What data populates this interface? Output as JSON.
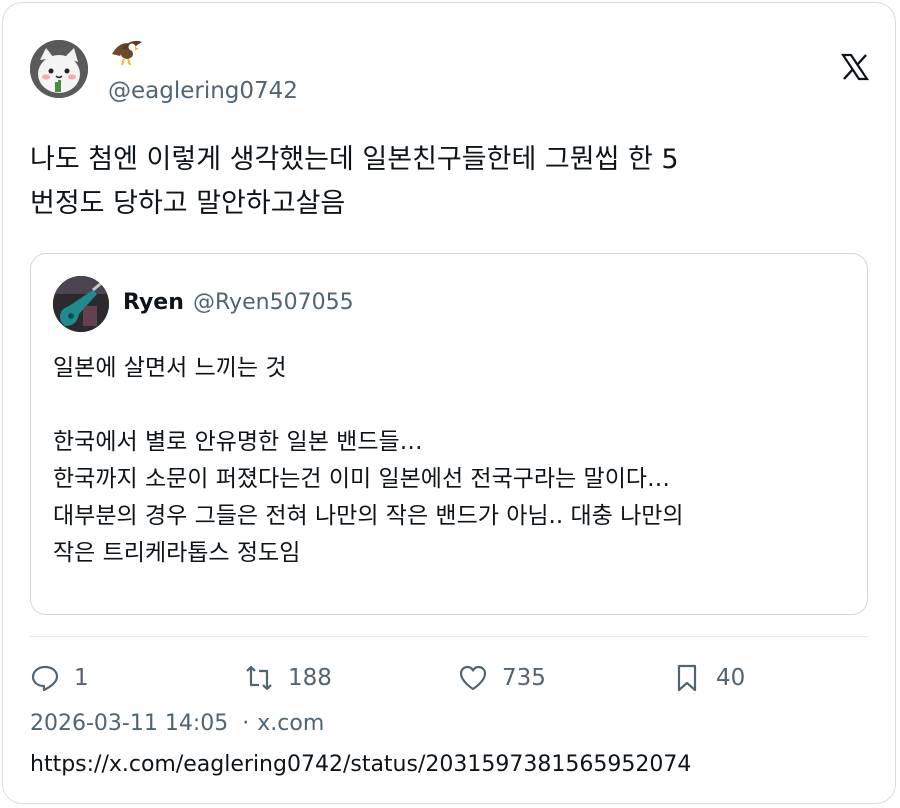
{
  "author": {
    "name_emoji": "eagle",
    "handle": "@eaglering0742"
  },
  "tweet": {
    "text": "나도 첨엔 이렇게 생각했는데 일본친구들한테 그뭔씹 한 5\n번정도 당하고 말안하고살음"
  },
  "quote": {
    "name": "Ryen",
    "handle": "@Ryen507055",
    "text": "일본에 살면서 느끼는 것\n\n한국에서 별로 안유명한 일본 밴드들…\n한국까지 소문이 퍼졌다는건 이미 일본에선 전국구라는 말이다…\n대부분의 경우 그들은 전혀 나만의 작은 밴드가 아님.. 대충 나만의\n작은 트리케라톱스 정도임"
  },
  "stats": {
    "replies": "1",
    "retweets": "188",
    "likes": "735",
    "bookmarks": "40"
  },
  "meta": {
    "timestamp": "2026-03-11 14:05",
    "separator": "·",
    "source": "x.com"
  },
  "url": "https://x.com/eaglering0742/status/2031597381565952074",
  "icons": {
    "logo": "x-logo-icon",
    "reply": "reply-icon",
    "retweet": "retweet-icon",
    "like": "heart-icon",
    "bookmark": "bookmark-icon"
  },
  "colors": {
    "text": "#0f1419",
    "secondary": "#536471",
    "border": "#cfd9de"
  }
}
